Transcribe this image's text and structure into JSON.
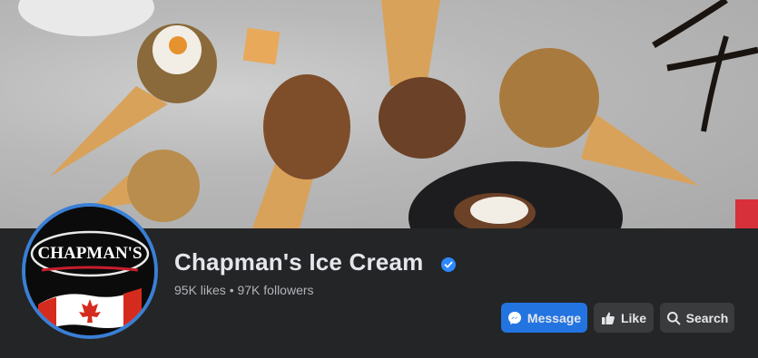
{
  "page": {
    "name": "Chapman's Ice Cream",
    "verified": true,
    "stats": "95K likes • 97K followers"
  },
  "avatar": {
    "brand_text": "CHAPMAN'S"
  },
  "actions": {
    "message_label": "Message",
    "like_label": "Like",
    "search_label": "Search"
  },
  "icons": {
    "verified": "verified-badge-icon",
    "message": "messenger-icon",
    "like": "thumbs-up-icon",
    "search": "search-icon"
  },
  "colors": {
    "background": "#242526",
    "primary_button": "#2374e1",
    "secondary_button": "#3a3b3c",
    "text_primary": "#e4e6eb",
    "text_secondary": "#b0b3b8",
    "avatar_ring": "#3a7fd5"
  }
}
